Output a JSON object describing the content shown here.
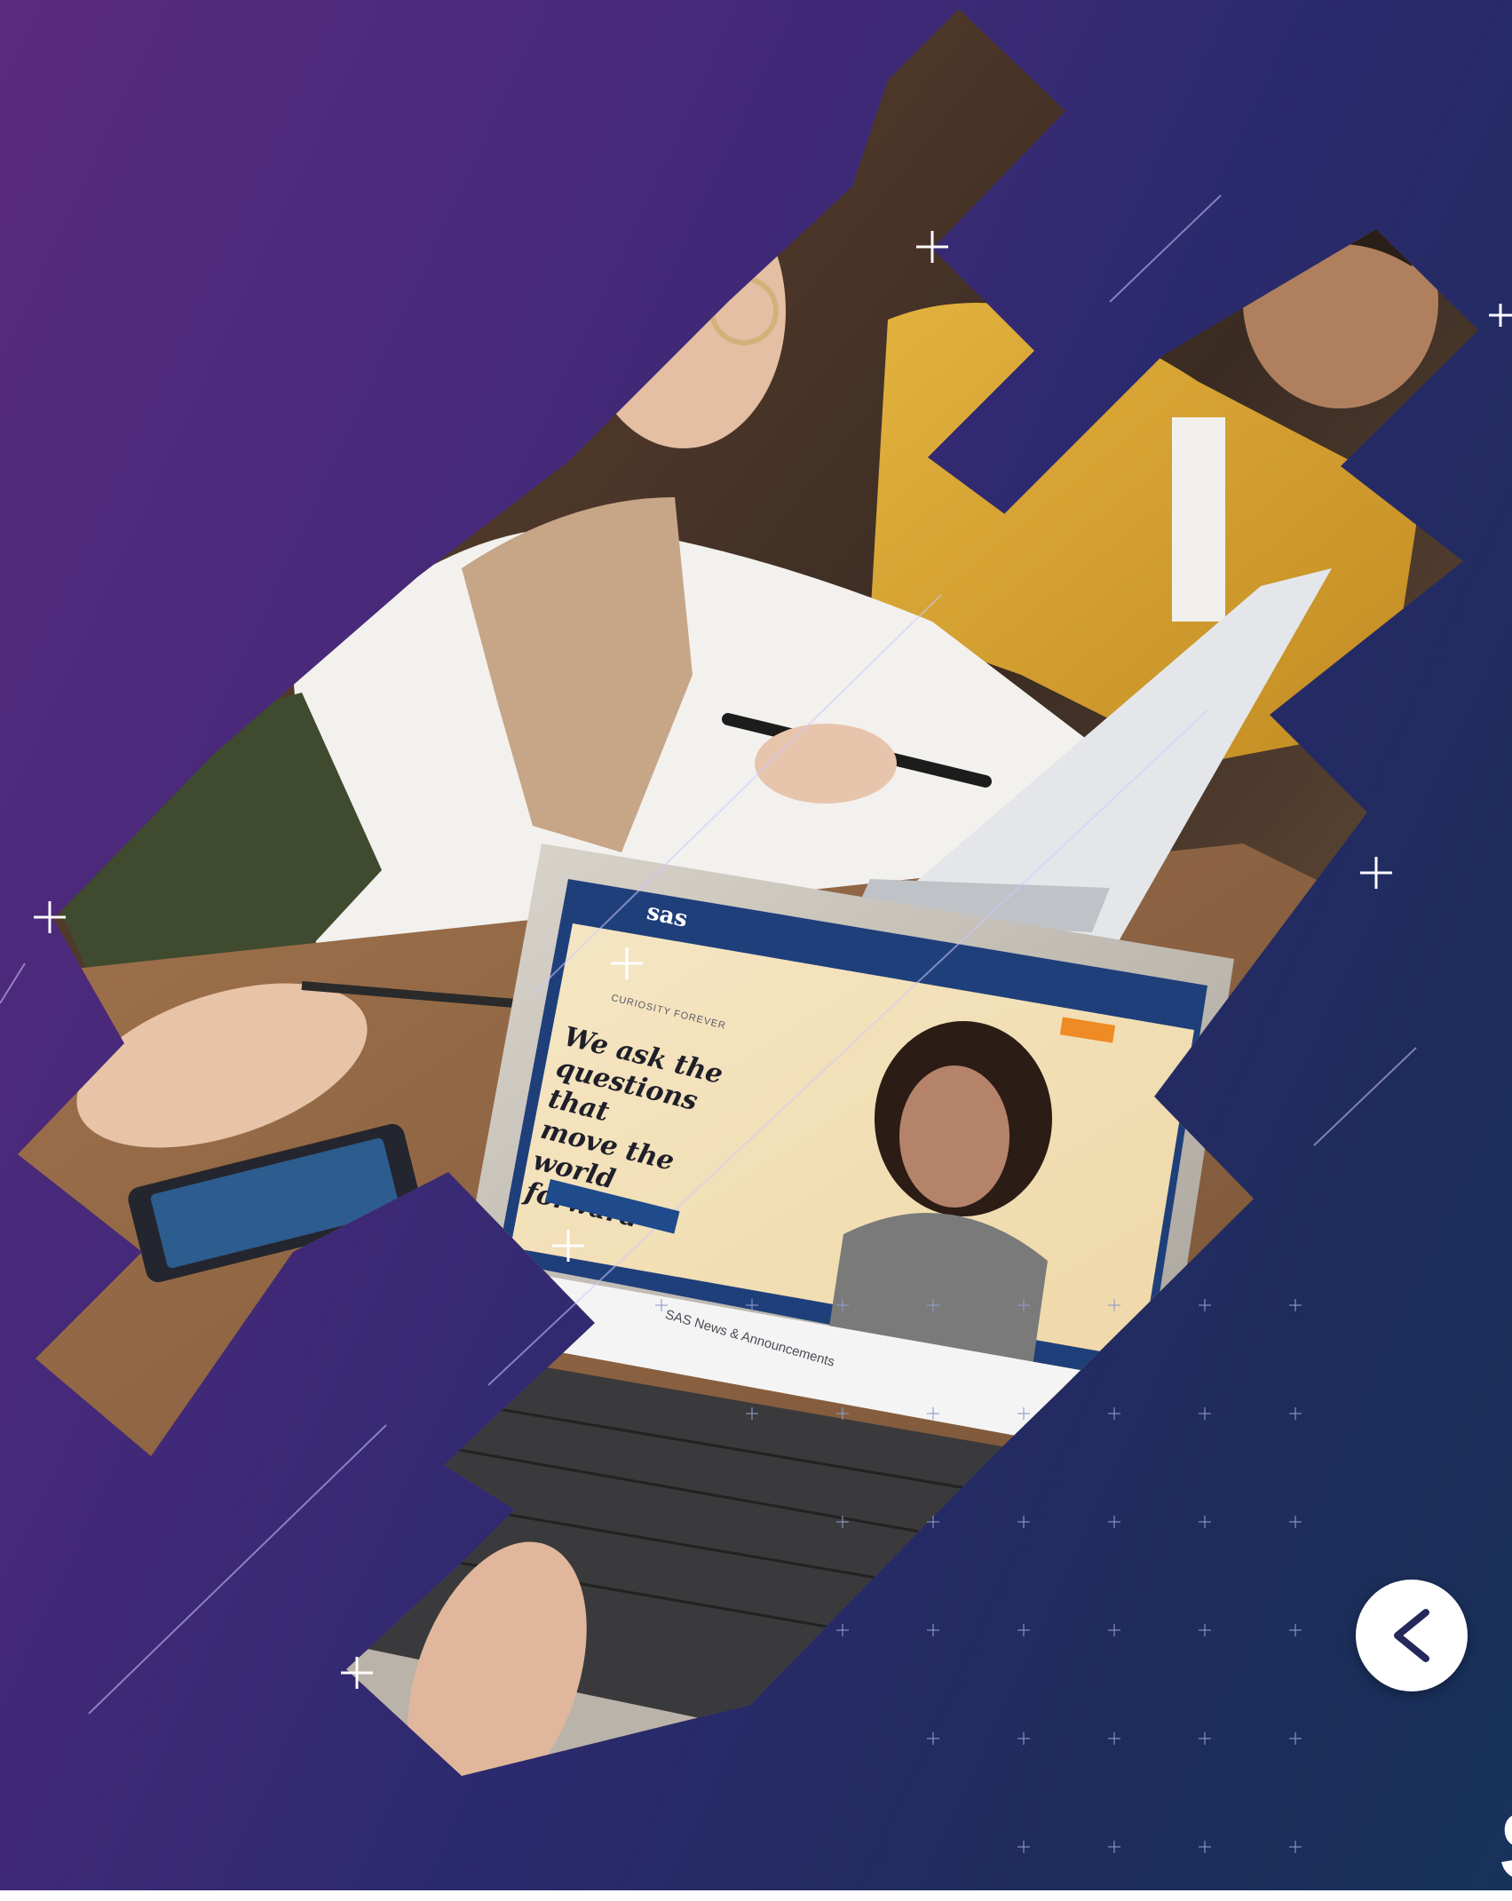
{
  "colors": {
    "bg_left": "#5a2a7e",
    "bg_right": "#17325a",
    "accent_orange": "#f08a24",
    "site_blue": "#1f4a8c"
  },
  "laptop_screen": {
    "logo": "sas",
    "eyebrow": "CURIOSITY FOREVER",
    "headline": "We ask the\nquestions that\nmove the world\nforward",
    "news_heading": "SAS News & Announcements"
  },
  "nav": {
    "back_button_icon": "chevron-left-icon"
  },
  "corner_glyph": "S"
}
